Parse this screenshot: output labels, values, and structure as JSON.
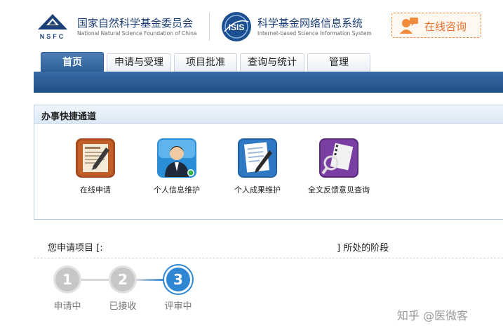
{
  "header": {
    "org_logo_text": "NSFC",
    "org_name_cn": "国家自然科学基金委员会",
    "org_name_en": "National Natural Science Foundation of China",
    "system_logo_text": "ISIS",
    "system_name_cn": "科学基金网络信息系统",
    "system_name_en": "Internet-based Science Information System",
    "consult_label": "在线咨询",
    "consult_icon": "customer-service-icon"
  },
  "nav": {
    "tabs": [
      {
        "label": "首页",
        "active": true
      },
      {
        "label": "申请与受理",
        "active": false
      },
      {
        "label": "项目批准",
        "active": false
      },
      {
        "label": "查询与统计",
        "active": false
      },
      {
        "label": "管理",
        "active": false
      }
    ]
  },
  "quick_access": {
    "title": "办事快捷通道",
    "items": [
      {
        "label": "在线申请",
        "icon": "form-pen-icon"
      },
      {
        "label": "个人信息维护",
        "icon": "person-icon"
      },
      {
        "label": "个人成果维护",
        "icon": "document-pen-icon"
      },
      {
        "label": "全文反馈意见查询",
        "icon": "magnifier-film-icon"
      }
    ]
  },
  "status": {
    "prefix": "您申请项目 [:",
    "suffix": "] 所处的阶段",
    "steps": [
      {
        "number": "1",
        "label": "申请中",
        "state": "done"
      },
      {
        "number": "2",
        "label": "已接收",
        "state": "done"
      },
      {
        "number": "3",
        "label": "评审中",
        "state": "current"
      }
    ]
  },
  "watermark": "知乎 @医微客",
  "colors": {
    "brand_blue": "#1f4d86",
    "accent_orange": "#e8702a",
    "step_current": "#2f86d3",
    "step_done": "#c7c7c7"
  }
}
